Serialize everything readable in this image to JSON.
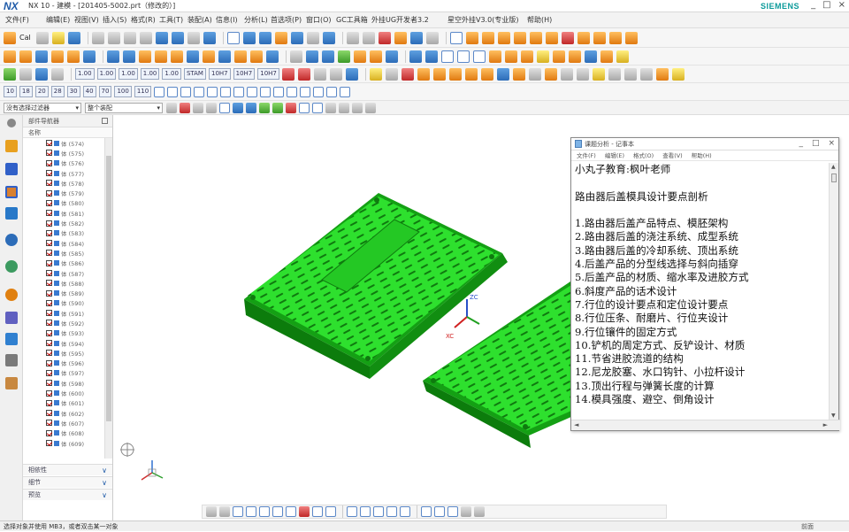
{
  "window": {
    "app_logo": "NX",
    "title": "NX 10 - 建模 - [201405-5002.prt（修改的）]",
    "brand": "SIEMENS",
    "controls": [
      "_",
      "□",
      "×"
    ]
  },
  "menubar": {
    "items": [
      "文件(F)",
      "编辑(E)",
      "视图(V)",
      "插入(S)",
      "格式(R)",
      "工具(T)",
      "装配(A)",
      "信息(I)",
      "分析(L)",
      "首选项(P)",
      "窗口(O)",
      "GC工具箱",
      "外挂UG开发者3.2",
      "星空外挂V3.0(专业版)",
      "帮助(H)"
    ]
  },
  "toolbar": {
    "start_label": "Cal",
    "number_buttons": [
      "1.00",
      "1.00",
      "1.00",
      "1.00",
      "1.00",
      "STAM",
      "10H7",
      "10H7",
      "10H7"
    ],
    "layer_buttons": [
      "10",
      "18",
      "20",
      "28",
      "30",
      "40",
      "70",
      "100",
      "110"
    ]
  },
  "filterbar": {
    "type_filter": "没有选择过滤器",
    "scope_filter": "整个装配"
  },
  "navigator": {
    "title": "部件导航器",
    "column_header": "名称",
    "items": [
      {
        "label": "体 (574)"
      },
      {
        "label": "体 (575)"
      },
      {
        "label": "体 (576)"
      },
      {
        "label": "体 (577)"
      },
      {
        "label": "体 (578)"
      },
      {
        "label": "体 (579)"
      },
      {
        "label": "体 (580)"
      },
      {
        "label": "体 (581)"
      },
      {
        "label": "体 (582)"
      },
      {
        "label": "体 (583)"
      },
      {
        "label": "体 (584)"
      },
      {
        "label": "体 (585)"
      },
      {
        "label": "体 (586)"
      },
      {
        "label": "体 (587)"
      },
      {
        "label": "体 (588)"
      },
      {
        "label": "体 (589)"
      },
      {
        "label": "体 (590)"
      },
      {
        "label": "体 (591)"
      },
      {
        "label": "体 (592)"
      },
      {
        "label": "体 (593)"
      },
      {
        "label": "体 (594)"
      },
      {
        "label": "体 (595)"
      },
      {
        "label": "体 (596)"
      },
      {
        "label": "体 (597)"
      },
      {
        "label": "体 (598)"
      },
      {
        "label": "体 (600)"
      },
      {
        "label": "体 (601)"
      },
      {
        "label": "体 (602)"
      },
      {
        "label": "体 (607)"
      },
      {
        "label": "体 (608)"
      },
      {
        "label": "体 (609)"
      }
    ],
    "sections": [
      "相依性",
      "细节",
      "预览"
    ]
  },
  "notepad": {
    "title": "课题分析 - 记事本",
    "menu": [
      "文件(F)",
      "编辑(E)",
      "格式(O)",
      "查看(V)",
      "帮助(H)"
    ],
    "lines": [
      "小丸子教育:枫叶老师",
      "",
      "路由器后盖模具设计要点剖析",
      "",
      "1.路由器后盖产品特点、模胚架构",
      "2.路由器后盖的浇注系统、成型系统",
      "3.路由器后盖的冷却系统、顶出系统",
      "4.后盖产品的分型线选择与斜向插穿",
      "5.后盖产品的材质、缩水率及进胶方式",
      "6.斜度产品的话术设计",
      "7.行位的设计要点和定位设计要点",
      "8.行位压条、耐磨片、行位夹设计",
      "9.行位镶件的固定方式",
      "10.铲机的周定方式、反铲设计、材质",
      "11.节省进胶流道的结构",
      "12.尼龙胶塞、水口钩针、小拉杆设计",
      "13.顶出行程与弹簧长度的计算",
      "14.模具强度、避空、倒角设计"
    ]
  },
  "triad": {
    "x": "XC",
    "z": "ZC"
  },
  "colors": {
    "part_green": "#22dd22",
    "accent_blue": "#1e5aa8",
    "brand_teal": "#0a9a9a"
  },
  "status": {
    "left": "选择对象并使用 MB3，或者双击某一对象",
    "right": "前面"
  }
}
